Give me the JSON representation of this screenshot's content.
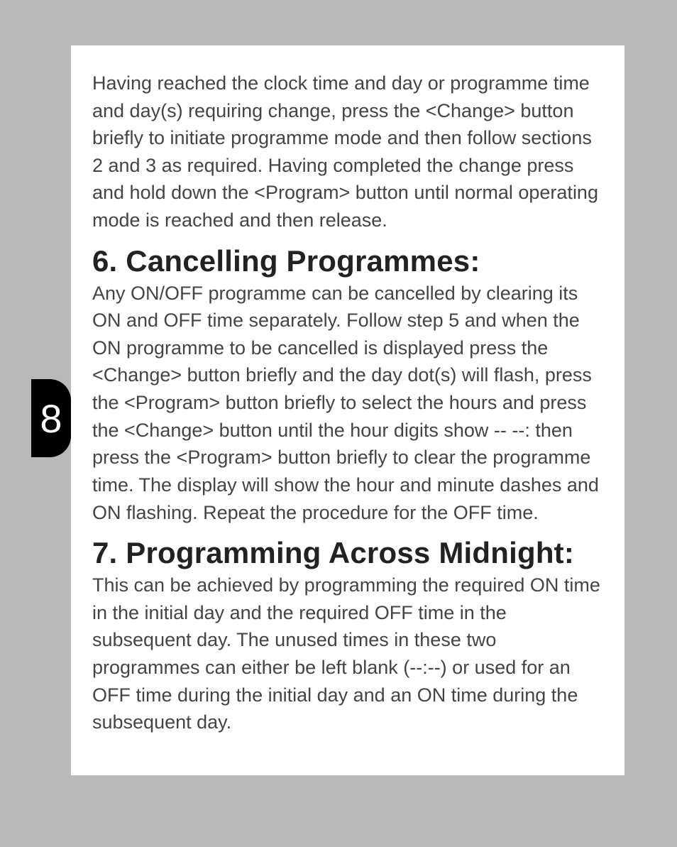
{
  "page_number": "8",
  "intro_paragraph": "Having reached the clock time and day or programme time and day(s) requiring change, press the <Change> button briefly to initiate programme mode and then follow sections 2 and 3 as required. Having completed the change press and hold down the <Program> button until normal operating mode is reached and then release.",
  "section6": {
    "heading": "6. Cancelling Programmes:",
    "body": "Any ON/OFF programme can be cancelled by clearing its ON and OFF time separately. Follow step 5 and when the ON programme to be cancelled is displayed press the <Change> button briefly and the day dot(s) will flash, press the <Program> button briefly to select the hours and press the <Change> button until the hour digits show -- --: then press the <Program> button briefly to clear the programme time. The display will show the hour and minute dashes and ON flashing. Repeat the procedure for the OFF time."
  },
  "section7": {
    "heading": "7. Programming Across Midnight:",
    "body": "This can be achieved by programming the required ON time in the initial day and the required OFF time in the subsequent day. The unused times in these two programmes can either be left blank (--:--) or used for an OFF time during the initial day and an ON time during the subsequent day."
  }
}
